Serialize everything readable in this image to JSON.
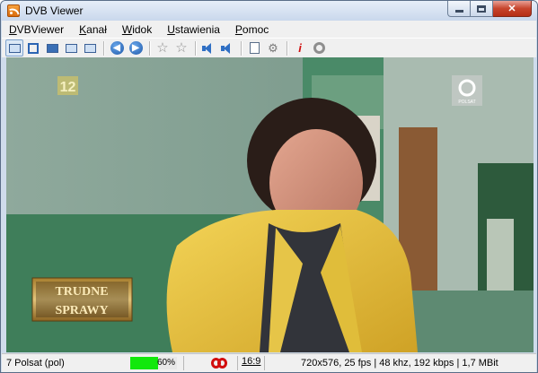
{
  "window": {
    "title": "DVB Viewer"
  },
  "menu": [
    {
      "label": "DVBViewer",
      "accel": "D",
      "rest": "VBViewer"
    },
    {
      "label": "Kanał",
      "accel": "K",
      "rest": "anał"
    },
    {
      "label": "Widok",
      "accel": "W",
      "rest": "idok"
    },
    {
      "label": "Ustawienia",
      "accel": "U",
      "rest": "stawienia"
    },
    {
      "label": "Pomoc",
      "accel": "P",
      "rest": "omoc"
    }
  ],
  "toolbar_icons": [
    "window-mode-icon",
    "fullscreen-icon",
    "osd-icon",
    "teletext-icon",
    "epg-icon",
    "back-icon",
    "forward-icon",
    "favorite-icon",
    "add-favorite-icon",
    "volume-down-icon",
    "volume-up-icon",
    "recordings-icon",
    "settings-icon",
    "info-icon",
    "record-icon"
  ],
  "osd": {
    "channel_logo": "12",
    "station_logo": "POLSAT",
    "show_title_line1": "TRUDNE",
    "show_title_line2": "SPRAWY"
  },
  "status": {
    "channel": "7 Polsat (pol)",
    "signal_text": "60%",
    "signal_level": 0.6,
    "aspect": "16:9",
    "stream_info": "720x576, 25 fps | 48 khz, 192 kbps | 1,7 MBit"
  },
  "colors": {
    "signal": "#12e80c",
    "record": "#d20e0e",
    "jacket": "#e8c33a"
  }
}
